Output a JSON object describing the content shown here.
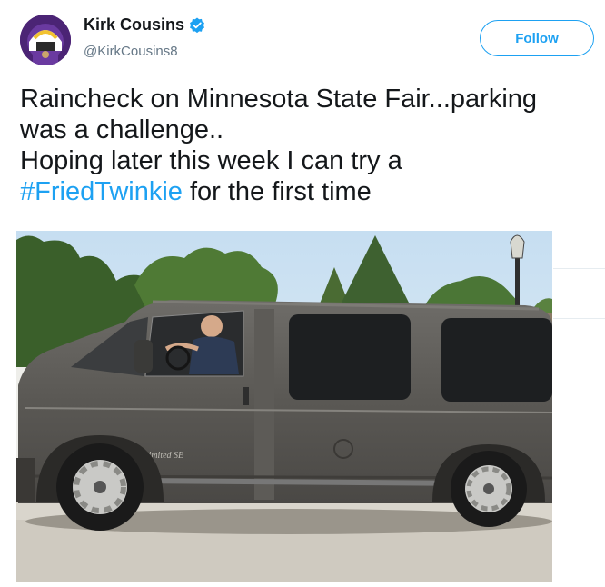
{
  "tweet": {
    "author": {
      "name": "Kirk Cousins",
      "handle": "@KirkCousins8",
      "verified": true
    },
    "follow_label": "Follow",
    "text_lines": [
      "Raincheck on Minnesota State Fair...parking",
      "was a challenge..",
      "Hoping later this week I can try a"
    ],
    "hashtag": "#FriedTwinkie",
    "text_after_hashtag": " for the first time",
    "colors": {
      "accent": "#1da1f2",
      "text": "#14171a",
      "secondary": "#657786"
    },
    "icons": [
      "verified-badge-icon"
    ],
    "photo": {
      "subject": "man-driving-gray-conversion-van"
    }
  }
}
